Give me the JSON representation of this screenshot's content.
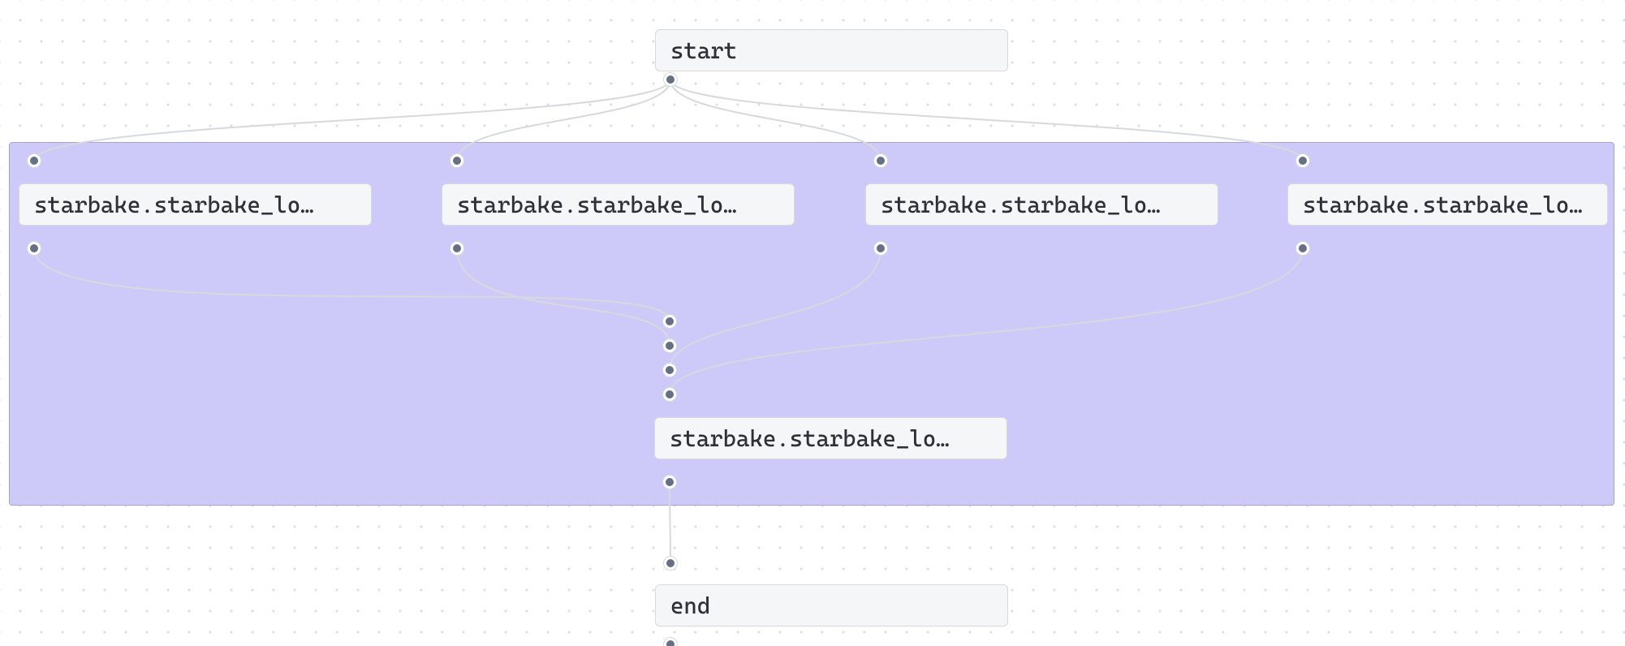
{
  "nodes": {
    "start": {
      "label": "start",
      "kind": "start"
    },
    "n1": {
      "label": "starbake.starbake_lo…",
      "kind": "task"
    },
    "n2": {
      "label": "starbake.starbake_lo…",
      "kind": "task"
    },
    "n3": {
      "label": "starbake.starbake_lo…",
      "kind": "task"
    },
    "n4": {
      "label": "starbake.starbake_lo…",
      "kind": "task"
    },
    "n5": {
      "label": "starbake.starbake_lo…",
      "kind": "task"
    },
    "end": {
      "label": "end",
      "kind": "end"
    }
  },
  "group": {
    "contains": [
      "n1",
      "n2",
      "n3",
      "n4",
      "n5"
    ],
    "background": "#cdcafa",
    "border": "#a5a2e0"
  },
  "edges": [
    {
      "from": "start",
      "to": "n1"
    },
    {
      "from": "start",
      "to": "n2"
    },
    {
      "from": "start",
      "to": "n3"
    },
    {
      "from": "start",
      "to": "n4"
    },
    {
      "from": "n1",
      "to": "n5"
    },
    {
      "from": "n2",
      "to": "n5"
    },
    {
      "from": "n3",
      "to": "n5"
    },
    {
      "from": "n4",
      "to": "n5"
    },
    {
      "from": "n5",
      "to": "end"
    }
  ],
  "colors": {
    "node_bg": "#f5f6f8",
    "node_border": "#d7d9dd",
    "text": "#2e3138",
    "edge": "#d7d9dd",
    "port_fill": "#667085",
    "port_border": "#ffffff",
    "canvas_dot": "#dcdfe4"
  }
}
